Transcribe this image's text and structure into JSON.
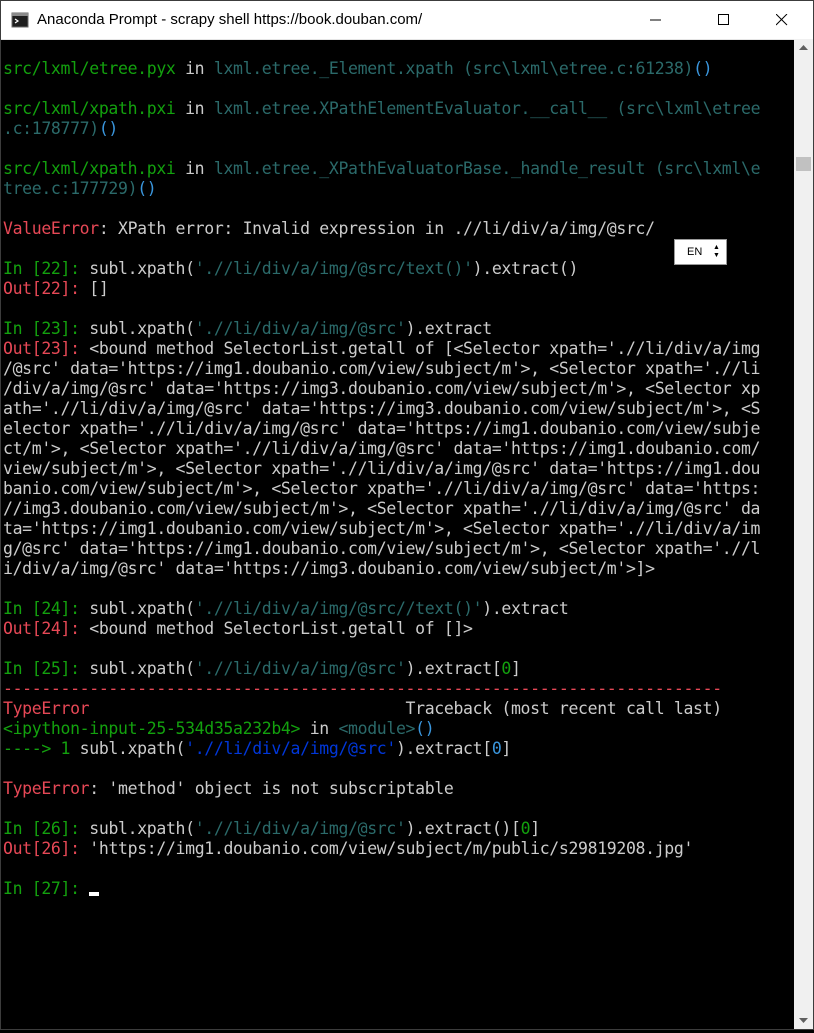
{
  "window": {
    "title": "Anaconda Prompt - scrapy  shell https://book.douban.com/"
  },
  "controls": {
    "min_icon": "minimize-icon",
    "max_icon": "maximize-icon",
    "close_icon": "close-icon"
  },
  "ime": {
    "label": "EN"
  },
  "console": {
    "l1": [
      "src/lxml/etree.pyx",
      " in ",
      "lxml.etree._Element.xpath",
      " (src\\lxml\\etree.c:61238)",
      "()"
    ],
    "l2a": [
      "src/lxml/xpath.pxi",
      " in ",
      "lxml.etree.XPathElementEvaluator.__call__",
      " (src\\lxml\\etree"
    ],
    "l2b": [
      ".c:178777)",
      "()"
    ],
    "l3a": [
      "src/lxml/xpath.pxi",
      " in ",
      "lxml.etree._XPathEvaluatorBase._handle_result",
      " (src\\lxml\\e"
    ],
    "l3b": [
      "tree.c:177729)",
      "()"
    ],
    "l4": [
      "ValueError",
      ": XPath error: Invalid expression in .//li/div/a/img/@src/"
    ],
    "l5": [
      "In [",
      "22",
      "]: ",
      "subl.xpath(",
      "'.//li/div/a/img/@src/text()'",
      ").extract()"
    ],
    "l6": [
      "Out[",
      "22",
      "]: ",
      "[]"
    ],
    "l7": [
      "In [",
      "23",
      "]: ",
      "subl.xpath(",
      "'.//li/div/a/img/@src'",
      ").extract"
    ],
    "l8": [
      "Out[",
      "23",
      "]: ",
      "<bound method SelectorList.getall of [<Selector xpath='.//li/div/a/img"
    ],
    "out23": [
      "/@src' data='https://img1.doubanio.com/view/subject/m'>, <Selector xpath='.//li",
      "/div/a/img/@src' data='https://img3.doubanio.com/view/subject/m'>, <Selector xp",
      "ath='.//li/div/a/img/@src' data='https://img3.doubanio.com/view/subject/m'>, <S",
      "elector xpath='.//li/div/a/img/@src' data='https://img1.doubanio.com/view/subje",
      "ct/m'>, <Selector xpath='.//li/div/a/img/@src' data='https://img1.doubanio.com/",
      "view/subject/m'>, <Selector xpath='.//li/div/a/img/@src' data='https://img1.dou",
      "banio.com/view/subject/m'>, <Selector xpath='.//li/div/a/img/@src' data='https:",
      "//img3.doubanio.com/view/subject/m'>, <Selector xpath='.//li/div/a/img/@src' da",
      "ta='https://img1.doubanio.com/view/subject/m'>, <Selector xpath='.//li/div/a/im",
      "g/@src' data='https://img1.doubanio.com/view/subject/m'>, <Selector xpath='.//l",
      "i/div/a/img/@src' data='https://img3.doubanio.com/view/subject/m'>]>"
    ],
    "l9": [
      "In [",
      "24",
      "]: ",
      "subl.xpath(",
      "'.//li/div/a/img/@src//text()'",
      ").extract"
    ],
    "l10": [
      "Out[",
      "24",
      "]: ",
      "<bound method SelectorList.getall of []>"
    ],
    "l11": [
      "In [",
      "25",
      "]: ",
      "subl.xpath(",
      "'.//li/div/a/img/@src'",
      ").extract[",
      "0",
      "]"
    ],
    "divider": "---------------------------------------------------------------------------",
    "l12": [
      "TypeError",
      "                                 Traceback (most recent call last)"
    ],
    "l13": [
      "<ipython-input-25-534d35a232b4>",
      " in ",
      "<module>",
      "()"
    ],
    "l14": [
      "----> 1 ",
      "subl.xpath(",
      "'.//li/div/a/img/@src'",
      ").extract[",
      "0",
      "]"
    ],
    "l15": [
      "TypeError",
      ": 'method' object is not subscriptable"
    ],
    "l16": [
      "In [",
      "26",
      "]: ",
      "subl.xpath(",
      "'.//li/div/a/img/@src'",
      ").extract()[",
      "0",
      "]"
    ],
    "l17": [
      "Out[",
      "26",
      "]: ",
      "'https://img1.doubanio.com/view/subject/m/public/s29819208.jpg'"
    ],
    "l18": [
      "In [",
      "27",
      "]: "
    ]
  }
}
